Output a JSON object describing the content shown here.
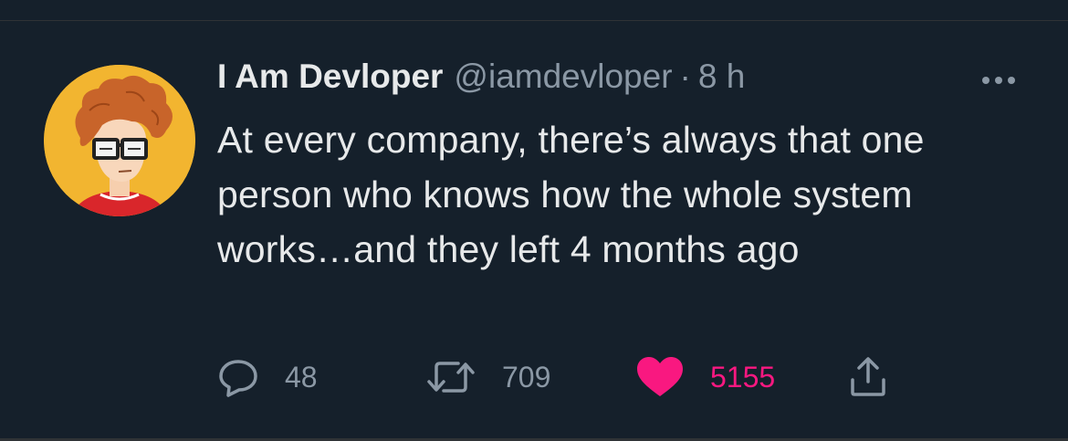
{
  "tweet": {
    "display_name": "I Am Devloper",
    "handle": "@iamdevloper",
    "separator": "·",
    "time": "8 h",
    "text": "At every company, there’s always that one person who knows how the whole system works…and they left 4 months ago",
    "reply_count": "48",
    "retweet_count": "709",
    "like_count": "5155"
  },
  "colors": {
    "background": "#15202b",
    "primary_text": "#e7e9ea",
    "secondary_text": "#8b98a5",
    "like": "#f91880",
    "avatar_bg": "#f2b530"
  },
  "icons": {
    "more": "more-dots-icon",
    "reply": "reply-bubble-icon",
    "retweet": "retweet-icon",
    "like": "heart-icon",
    "share": "share-upload-icon"
  }
}
